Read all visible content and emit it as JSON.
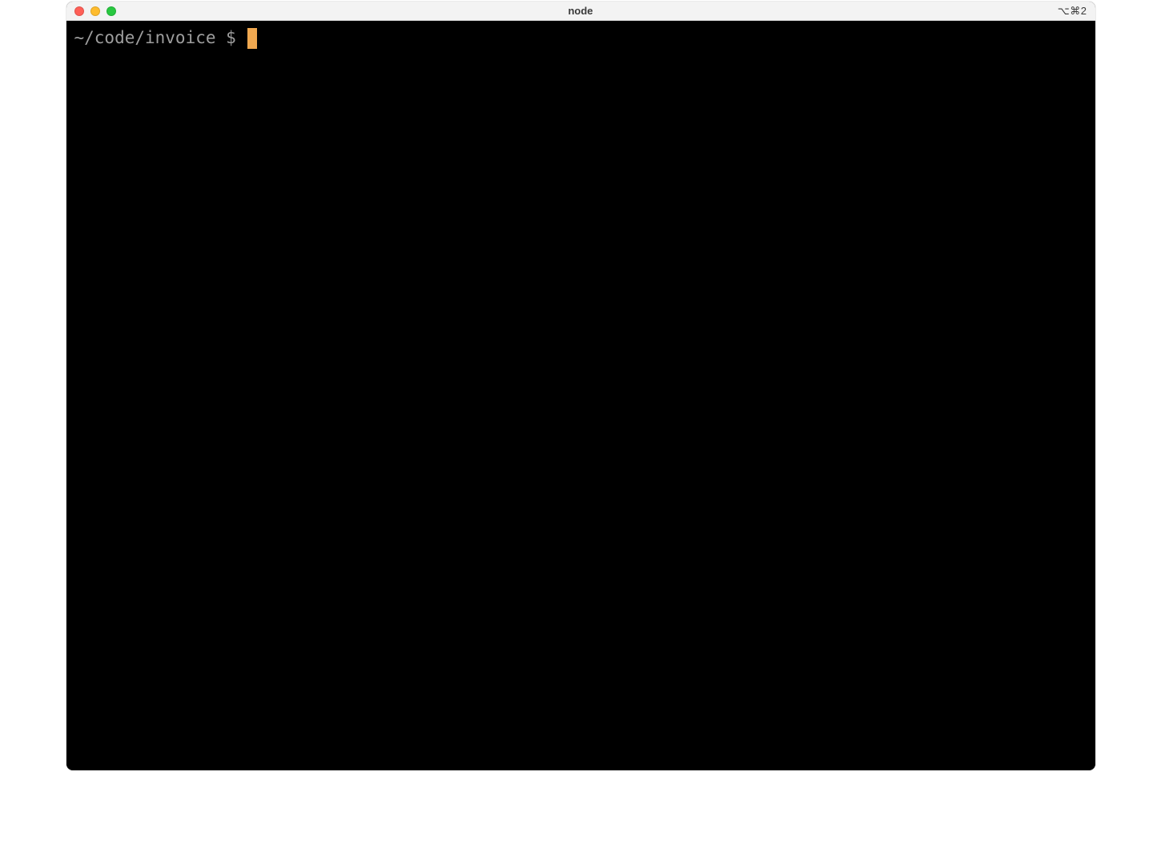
{
  "window": {
    "title": "node",
    "shortcut_label": "⌥⌘2"
  },
  "terminal": {
    "prompt": "~/code/invoice $ ",
    "input": ""
  },
  "colors": {
    "cursor": "#f0a850",
    "prompt_text": "#9e9e9e",
    "background": "#000000"
  }
}
